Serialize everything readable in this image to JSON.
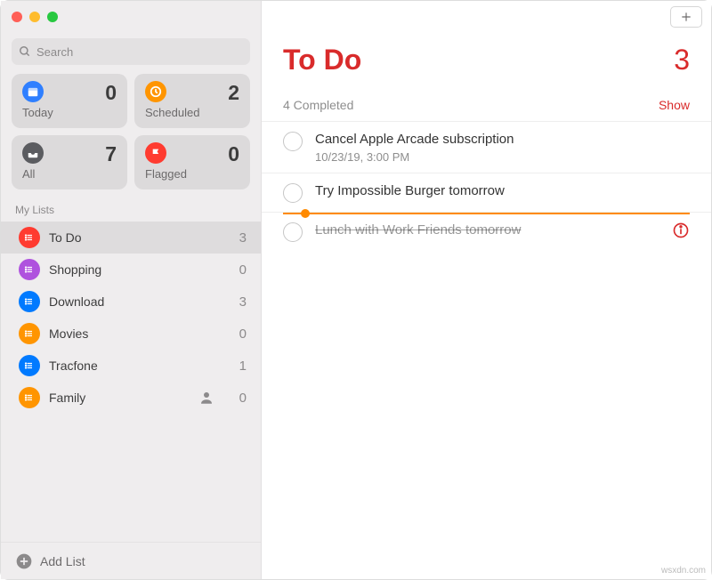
{
  "window": {
    "search_placeholder": "Search"
  },
  "smart": {
    "today": {
      "label": "Today",
      "count": "0",
      "color": "#2f7fff"
    },
    "scheduled": {
      "label": "Scheduled",
      "count": "2",
      "color": "#ff9500"
    },
    "all": {
      "label": "All",
      "count": "7",
      "color": "#5b5c60"
    },
    "flagged": {
      "label": "Flagged",
      "count": "0",
      "color": "#ff3b30"
    }
  },
  "section_label": "My Lists",
  "lists": [
    {
      "name": "To Do",
      "count": "3",
      "color": "#ff3b30",
      "selected": true
    },
    {
      "name": "Shopping",
      "count": "0",
      "color": "#af52de"
    },
    {
      "name": "Download",
      "count": "3",
      "color": "#007aff"
    },
    {
      "name": "Movies",
      "count": "0",
      "color": "#ff9500"
    },
    {
      "name": "Tracfone",
      "count": "1",
      "color": "#007aff"
    },
    {
      "name": "Family",
      "count": "0",
      "color": "#ff9500",
      "shared": true
    }
  ],
  "footer": {
    "add_list": "Add List"
  },
  "main": {
    "title": "To Do",
    "count": "3",
    "completed_label": "4 Completed",
    "show_label": "Show"
  },
  "todos": [
    {
      "title": "Cancel Apple Arcade subscription",
      "sub": "10/23/19, 3:00 PM"
    },
    {
      "title": "Try Impossible Burger tomorrow"
    },
    {
      "title": "Lunch with Work Friends tomorrow",
      "dragging": true,
      "info": true
    }
  ],
  "watermark": "wsxdn.com"
}
